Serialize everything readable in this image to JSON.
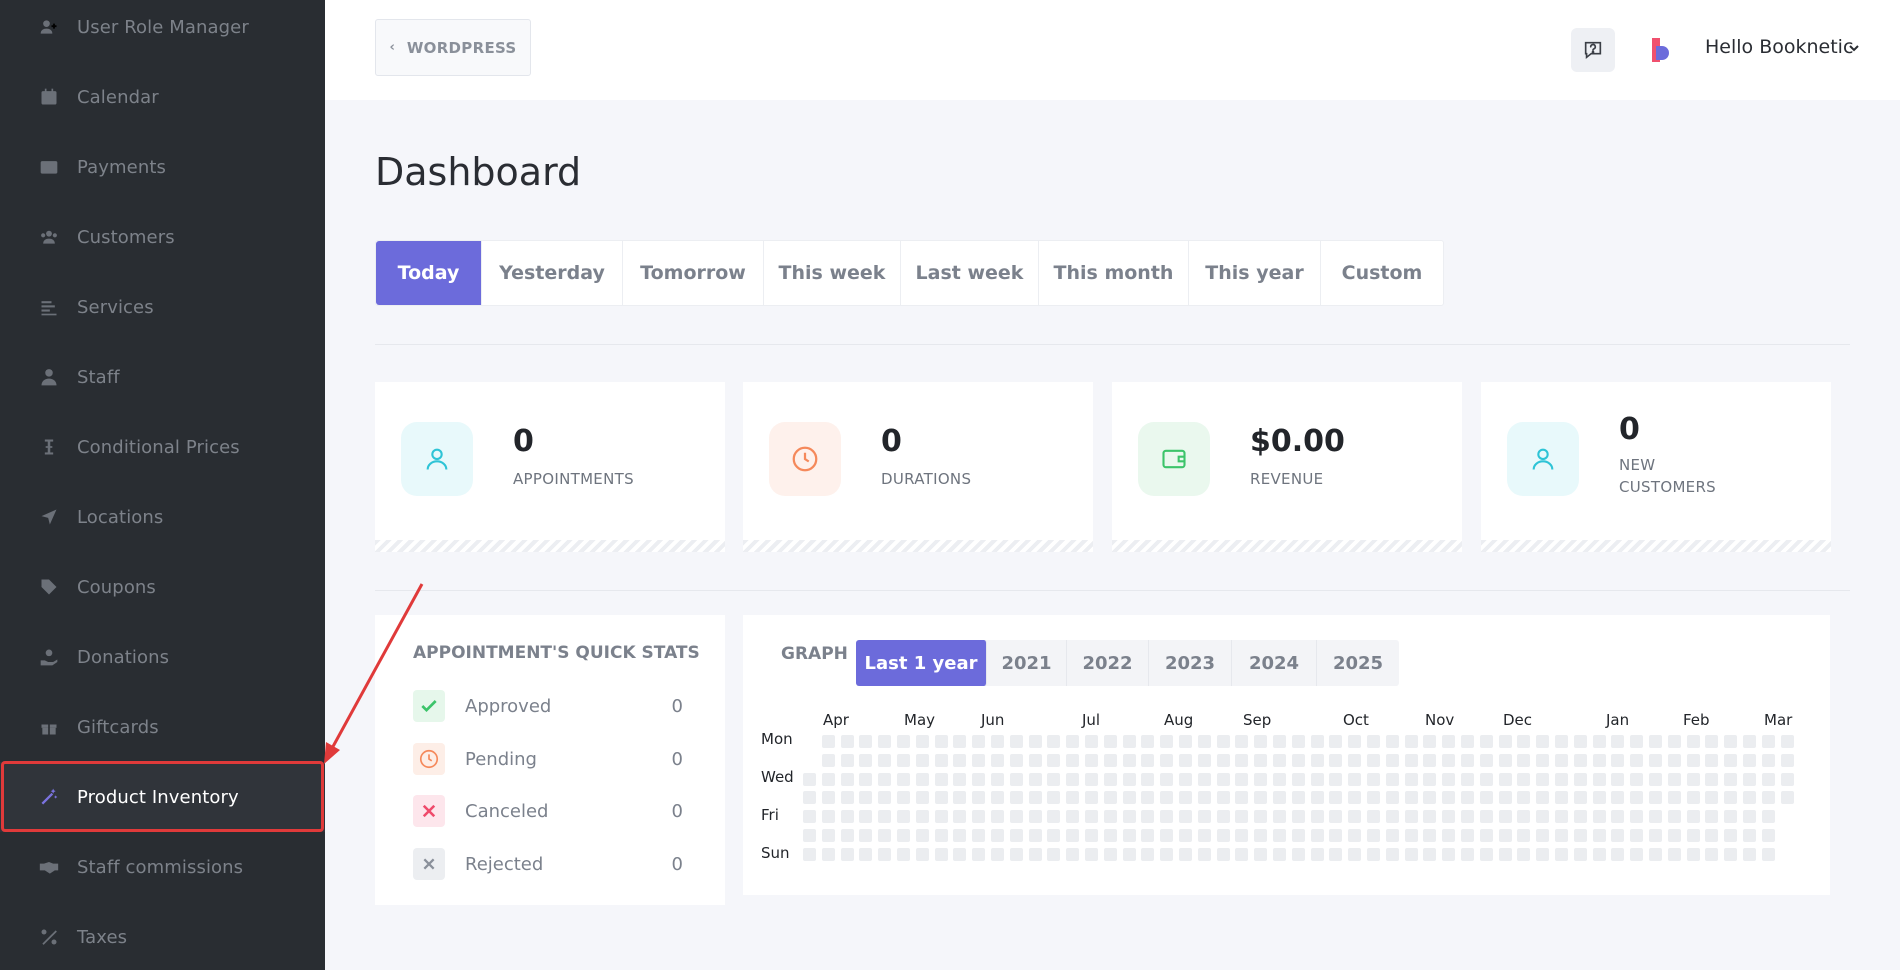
{
  "sidebar": {
    "items": [
      {
        "label": "User Role Manager",
        "icon": "user-plus-icon"
      },
      {
        "label": "Calendar",
        "icon": "calendar-icon"
      },
      {
        "label": "Payments",
        "icon": "wallet-icon"
      },
      {
        "label": "Customers",
        "icon": "users-icon"
      },
      {
        "label": "Services",
        "icon": "list-icon"
      },
      {
        "label": "Staff",
        "icon": "user-icon"
      },
      {
        "label": "Conditional Prices",
        "icon": "i-beam-icon"
      },
      {
        "label": "Locations",
        "icon": "location-arrow-icon"
      },
      {
        "label": "Coupons",
        "icon": "tag-icon"
      },
      {
        "label": "Donations",
        "icon": "hand-holding-icon"
      },
      {
        "label": "Giftcards",
        "icon": "gift-icon"
      },
      {
        "label": "Product Inventory",
        "icon": "magic-wand-icon"
      },
      {
        "label": "Staff commissions",
        "icon": "handshake-icon"
      },
      {
        "label": "Taxes",
        "icon": "percent-icon"
      }
    ],
    "active_index": 11
  },
  "header": {
    "back_label": "WORDPRESS",
    "user_greeting": "Hello Booknetic"
  },
  "page": {
    "title": "Dashboard",
    "tabs": [
      "Today",
      "Yesterday",
      "Tomorrow",
      "This week",
      "Last week",
      "This month",
      "This year",
      "Custom"
    ],
    "active_tab": "Today"
  },
  "stats": [
    {
      "value": "0",
      "caption": "APPOINTMENTS",
      "icon": "user-icon",
      "color": "#2ec4d6"
    },
    {
      "value": "0",
      "caption": "DURATIONS",
      "icon": "clock-icon",
      "color": "#f5895b"
    },
    {
      "value": "$0.00",
      "caption": "REVENUE",
      "icon": "wallet-icon",
      "color": "#3cc46a"
    },
    {
      "value": "0",
      "caption": "NEW\nCUSTOMERS",
      "icon": "user-icon",
      "color": "#2ec4d6"
    }
  ],
  "quick_stats": {
    "title": "APPOINTMENT'S QUICK STATS",
    "rows": [
      {
        "label": "Approved",
        "value": "0",
        "icon": "check-icon",
        "color": "#3cc46a"
      },
      {
        "label": "Pending",
        "value": "0",
        "icon": "clock-icon",
        "color": "#f5895b"
      },
      {
        "label": "Canceled",
        "value": "0",
        "icon": "x-icon",
        "color": "#ef4a6b"
      },
      {
        "label": "Rejected",
        "value": "0",
        "icon": "x-icon",
        "color": "#8a909a"
      }
    ]
  },
  "graph": {
    "label": "GRAPH",
    "tabs": [
      "Last 1 year",
      "2021",
      "2022",
      "2023",
      "2024",
      "2025"
    ],
    "active_tab": "Last 1 year",
    "months": [
      "Apr",
      "May",
      "Jun",
      "Jul",
      "Aug",
      "Sep",
      "Oct",
      "Nov",
      "Dec",
      "Jan",
      "Feb",
      "Mar"
    ],
    "day_labels": [
      "Mon",
      "Wed",
      "Fri",
      "Sun"
    ]
  },
  "colors": {
    "accent": "#6c6bdb",
    "sidebar_bg": "#292d32",
    "highlight": "#e03a3a"
  }
}
